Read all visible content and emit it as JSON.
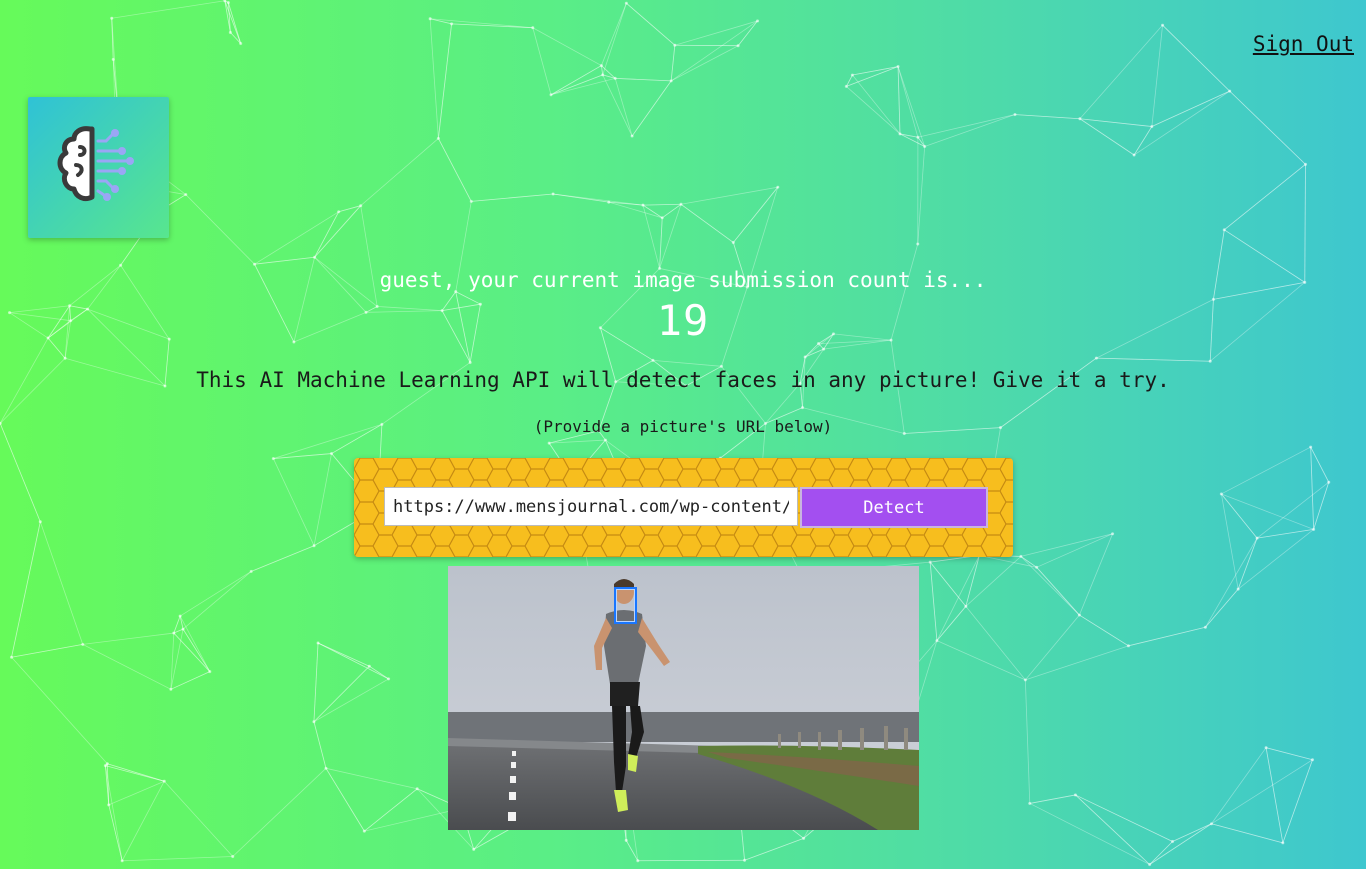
{
  "header": {
    "signout_label": "Sign Out"
  },
  "logo": {
    "icon": "brain-circuit-icon",
    "gradient": [
      "#2fc2d6",
      "#58e68e"
    ]
  },
  "greeting": {
    "text": "guest, your current image submission count is...",
    "count": "19"
  },
  "main": {
    "headline": "This AI Machine Learning API will detect faces in any picture! Give it a try.",
    "hint": "(Provide a picture's URL below)"
  },
  "form": {
    "url_value": "https://www.mensjournal.com/wp-content/",
    "button_label": "Detect"
  },
  "image": {
    "subject": "photo-runner-on-road"
  },
  "colors": {
    "bg_left": "#66fa5a",
    "bg_right": "#3ec7cf",
    "panel": "#f7be1e",
    "button": "#a34ff0",
    "face_box": "#1976ff"
  }
}
